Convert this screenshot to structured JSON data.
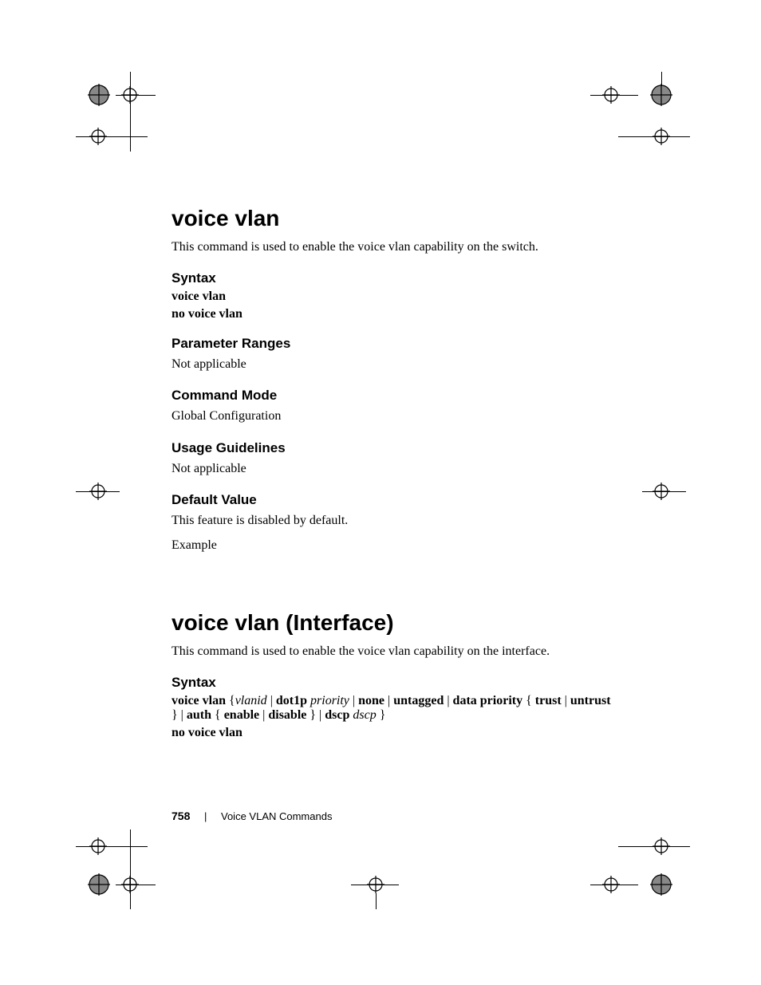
{
  "sections": [
    {
      "title": "voice vlan",
      "intro": "This command is used to enable the voice vlan capability on the switch.",
      "syntax_heading": "Syntax",
      "syntax_lines": [
        [
          {
            "t": "voice vlan",
            "b": true
          }
        ],
        [
          {
            "t": "no voice vlan",
            "b": true
          }
        ]
      ],
      "subs": [
        {
          "h": "Parameter Ranges",
          "p": "Not applicable"
        },
        {
          "h": "Command Mode",
          "p": "Global Configuration"
        },
        {
          "h": "Usage Guidelines",
          "p": "Not applicable"
        },
        {
          "h": "Default Value",
          "p": "This feature is disabled by default.",
          "p2": "Example"
        }
      ]
    },
    {
      "title": "voice vlan (Interface)",
      "intro": "This command is used to enable the voice vlan capability on the interface.",
      "syntax_heading": "Syntax",
      "syntax_lines": [
        [
          {
            "t": "voice vlan",
            "b": true
          },
          {
            "t": " {"
          },
          {
            "t": "vlanid",
            "i": true
          },
          {
            "t": " | "
          },
          {
            "t": "dot1p",
            "b": true
          },
          {
            "t": " "
          },
          {
            "t": "priority",
            "i": true
          },
          {
            "t": " | "
          },
          {
            "t": "none",
            "b": true
          },
          {
            "t": " | "
          },
          {
            "t": "untagged",
            "b": true
          },
          {
            "t": " | "
          },
          {
            "t": "data priority",
            "b": true
          },
          {
            "t": " { "
          },
          {
            "t": "trust",
            "b": true
          },
          {
            "t": " | "
          },
          {
            "t": "untrust",
            "b": true
          },
          {
            "t": " } | "
          },
          {
            "t": "auth",
            "b": true
          },
          {
            "t": " { "
          },
          {
            "t": "enable",
            "b": true
          },
          {
            "t": " | "
          },
          {
            "t": "disable",
            "b": true
          },
          {
            "t": " } | "
          },
          {
            "t": "dscp",
            "b": true
          },
          {
            "t": " "
          },
          {
            "t": "dscp",
            "i": true
          },
          {
            "t": " }"
          }
        ],
        [
          {
            "t": "no voice vlan",
            "b": true
          }
        ]
      ],
      "subs": []
    }
  ],
  "footer": {
    "page": "758",
    "title": "Voice VLAN Commands"
  }
}
